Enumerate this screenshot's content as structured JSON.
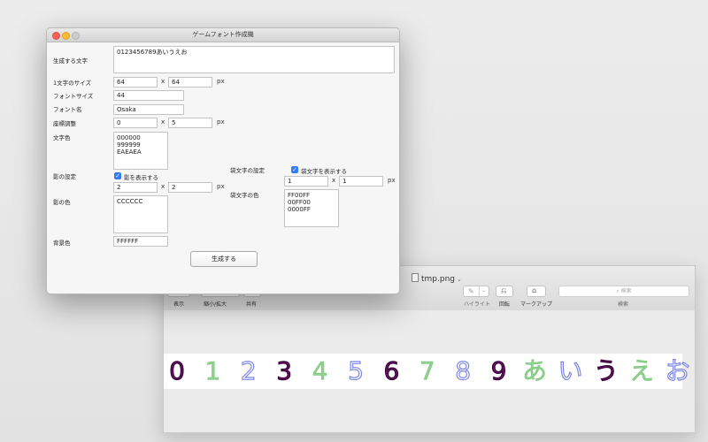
{
  "main_window": {
    "title": "ゲームフォント作成機",
    "chars_label": "生成する文字",
    "chars_value": "0123456789あいうえお",
    "size_label": "1文字のサイズ",
    "size_w": "64",
    "size_h": "64",
    "x_sep": "x",
    "px_unit": "px",
    "font_size_label": "フォントサイズ",
    "font_size_value": "44",
    "font_name_label": "フォント名",
    "font_name_value": "Osaka",
    "offset_label": "座標調整",
    "offset_x": "0",
    "offset_y": "5",
    "text_color_label": "文字色",
    "text_colors": [
      "000000",
      "999999",
      "EAEAEA"
    ],
    "shadow_label": "影の設定",
    "shadow_checkbox_label": "影を表示する",
    "shadow_checked": true,
    "shadow_x": "2",
    "shadow_y": "2",
    "shadow_color_label": "影の色",
    "shadow_colors": [
      "CCCCCC"
    ],
    "outline_label": "袋文字の設定",
    "outline_checkbox_label": "袋文字を表示する",
    "outline_checked": true,
    "outline_x": "1",
    "outline_y": "1",
    "outline_color_label": "袋文字の色",
    "outline_colors": [
      "FF00FF",
      "00FF00",
      "0000FF"
    ],
    "bg_color_label": "背景色",
    "bg_color_value": "FFFFFF",
    "generate_button": "生成する"
  },
  "preview_window": {
    "title": "tmp.png",
    "toolbar_labels": {
      "view": "表示",
      "zoom": "縮小/拡大",
      "share": "共有",
      "highlight": "ハイライト",
      "rotate": "回転",
      "markup": "マークアップ",
      "search": "検索"
    },
    "search_placeholder": "検索",
    "glyphs": [
      {
        "char": "0",
        "style": "purple"
      },
      {
        "char": "1",
        "style": "green"
      },
      {
        "char": "2",
        "style": "outline"
      },
      {
        "char": "3",
        "style": "purple"
      },
      {
        "char": "4",
        "style": "green"
      },
      {
        "char": "5",
        "style": "outline"
      },
      {
        "char": "6",
        "style": "purple"
      },
      {
        "char": "7",
        "style": "green"
      },
      {
        "char": "8",
        "style": "outline"
      },
      {
        "char": "9",
        "style": "purple"
      },
      {
        "char": "あ",
        "style": "green"
      },
      {
        "char": "い",
        "style": "outline"
      },
      {
        "char": "う",
        "style": "purple"
      },
      {
        "char": "え",
        "style": "green"
      },
      {
        "char": "お",
        "style": "outline"
      }
    ]
  },
  "colors": {
    "purple": "#6a0f62",
    "green": "#8fd38f",
    "outline": "#7d86e6",
    "checkbox": "#2f7cf6"
  }
}
